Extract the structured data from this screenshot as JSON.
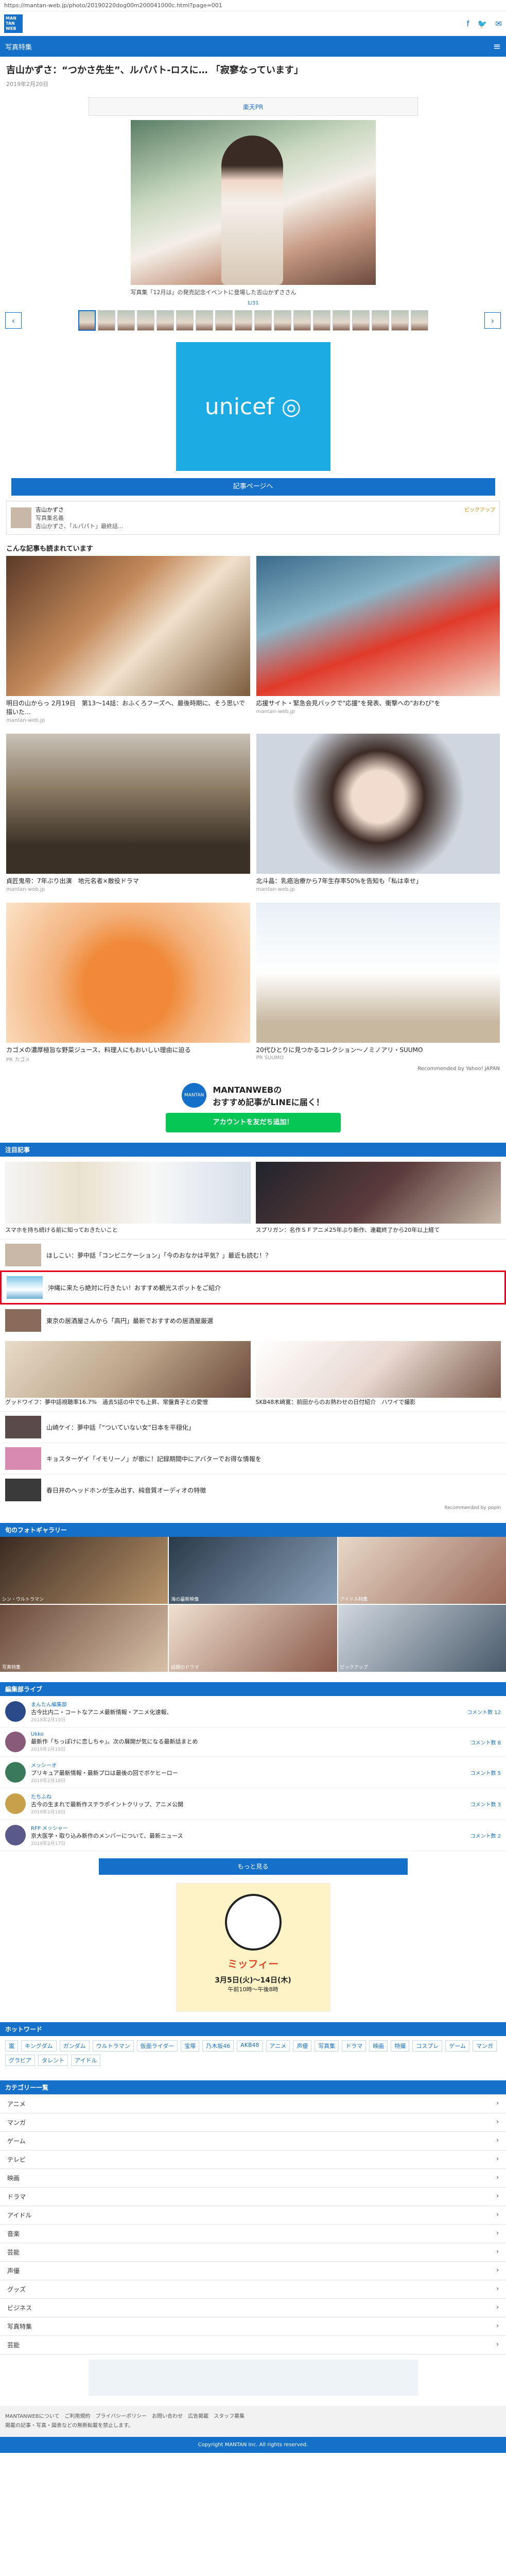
{
  "url": "https://mantan-web.jp/photo/20190220dog00m200041000c.html?page=001",
  "header": {
    "logo_lines": [
      "MAN",
      "TAN",
      "WEB"
    ],
    "icons": [
      "facebook-icon",
      "twitter-icon",
      "email-icon"
    ]
  },
  "gnav": {
    "label": "写真特集",
    "menu": "≡"
  },
  "article": {
    "title": "吉山かずさ：“つかさ先生”、ルパバト-ロスに… 「寂寥なっています」",
    "date": "2019年2月20日",
    "ad_text": "楽天PR",
    "photo_caption": "写真集「12月は」の発売記念イベントに登場した吉山かずささん",
    "thumb_count": "1/31"
  },
  "thumbs": 18,
  "buttons": {
    "photo_list": "記事ページへ"
  },
  "author": {
    "name": "吉山かずさ",
    "org": "写真集名義",
    "desc": "吉山かずさ、「ルパパト」最終話...",
    "tag": "ピックアップ"
  },
  "recommend": {
    "title": "こんな記事も読まれています",
    "cards": [
      {
        "cap": "明日の山からっ 2月19日　第13〜14話：おふくろフーズへ、最後時期に、そう思いで描いた…",
        "src": "mantan-web.jp"
      },
      {
        "cap": "応援サイト・緊急会見バックで\"応援\"を発表、衝撃への\"おわび\"を",
        "src": "mantan-web.jp"
      },
      {
        "cap": "貞匠鬼帝：7年ぶり出演　地元名者×敵役ドラマ",
        "src": "mantan-web.jp"
      },
      {
        "cap": "北斗晶：乳癌治療から7年生存率50%を告知も「私は幸せ」",
        "src": "mantan-web.jp"
      },
      {
        "cap": "カゴメの濃厚極旨な野菜ジュース、料理人にもおいしい理由に迫る",
        "src": "PR カゴメ"
      },
      {
        "cap": "20代ひとりに見つかるコレクション〜ノミノアリ・SUUMO",
        "src": "PR SUUMO"
      }
    ],
    "note": "Recommended by Yahoo! JAPAN"
  },
  "line": {
    "title1": "MANTANWEBの",
    "title2": "おすすめ記事がLINEに届く！",
    "button": "アカウントを友だち追加！"
  },
  "news_section": {
    "title": "注目記事",
    "top": [
      {
        "t": "スマホを持ち続ける前に知っておきたいこと"
      },
      {
        "t": "スプリガン：名作ＳＦアニメ25年ぶり新作、連載終了から20年以上経て"
      }
    ],
    "rows": [
      "ほしこい：夢中話「コンビニケーション」「今のおなかは平気？」最近も読む！？",
      "沖縄に来たら絶対に行きたい！おすすめ観光スポットをご紹介",
      "東京の居酒屋さんから「高円」最新でおすすめの居酒屋厳選",
      "グッドワイフ：夢物語視聴率16.7%　過去5話の中でも上昇",
      "山崎ケイ：夢中話「“ついていない女”日本を平穏化」",
      "キョスターゲイ「イモリーノ」が歌に！記録期間中にアバターでお得な情報を",
      "春日井のヘッドホンが生み出す、純音質オーディオの特徴"
    ],
    "pair": [
      "グッドワイフ：夢中話視聴率16.7%　過去5話の中でも上昇、常盤貴子との愛憎",
      "SKB48木崎寛：前田からのお熱わせの日付紹介　ハワイで撮影"
    ],
    "highlight_index": 1,
    "ad_note": "Recommended by popIn"
  },
  "photo_section": {
    "title": "旬のフォトギャラリー",
    "cells": [
      "シン・ウルトラマン",
      "海の最新映像",
      "アイドル特集",
      "写真特集",
      "話題のドラマ",
      "ピックアップ"
    ]
  },
  "live_section": {
    "title": "編集部ライブ",
    "items": [
      {
        "name": "まんたん編集部",
        "msg": "古今比内二・コートなアニメ最新情報・アニメ化速報、",
        "time": "2019年2月19日",
        "cnt": "コメント数 12"
      },
      {
        "name": "Ukko",
        "msg": "最新作「ちっぽけに恋しちゃ」。次の展開が気になる最新話まとめ",
        "time": "2019年2月19日",
        "cnt": "コメント数 8"
      },
      {
        "name": "メッシーオ",
        "msg": "プリキュア最新情報・最新プロは最後の回でボケヒーロー",
        "time": "2019年2月18日",
        "cnt": "コメント数 5"
      },
      {
        "name": "たちふね",
        "msg": "古今の生まれで最新作ステラポイントクリップ、アニメ公開",
        "time": "2019年2月18日",
        "cnt": "コメント数 3"
      },
      {
        "name": "RFP メッシャー",
        "msg": "京大医学・取り込み新作のメンバーについて、最新ニュース",
        "time": "2019年2月17日",
        "cnt": "コメント数 2"
      }
    ],
    "more": "もっと見る"
  },
  "miffy": {
    "title": "ミッフィー",
    "dates": "3月5日(火)～14日(木)",
    "venue": "午前10時～午後8時"
  },
  "keywords": {
    "title": "ホットワード",
    "list": [
      "嵐",
      "キングダム",
      "ガンダム",
      "ウルトラマン",
      "仮面ライダー",
      "宝塚",
      "乃木坂46",
      "AKB48",
      "アニメ",
      "声優",
      "写真集",
      "ドラマ",
      "映画",
      "特撮",
      "コスプレ",
      "ゲーム",
      "マンガ",
      "グラビア",
      "タレント",
      "アイドル"
    ]
  },
  "categories": {
    "title": "カテゴリー一覧",
    "items": [
      "アニメ",
      "マンガ",
      "ゲーム",
      "テレビ",
      "映画",
      "ドラマ",
      "アイドル",
      "音楽",
      "芸能",
      "声優",
      "グッズ",
      "ビジネス",
      "写真特集",
      "芸能"
    ]
  },
  "footer": {
    "links": [
      "MANTANWEBについて",
      "ご利用規約",
      "プライバシーポリシー",
      "お問い合わせ",
      "広告掲載",
      "スタッフ募集"
    ],
    "notice": "掲載の記事・写真・図表などの無断転載を禁止します。",
    "copyright": "Copyright MANTAN Inc. All rights reserved."
  }
}
